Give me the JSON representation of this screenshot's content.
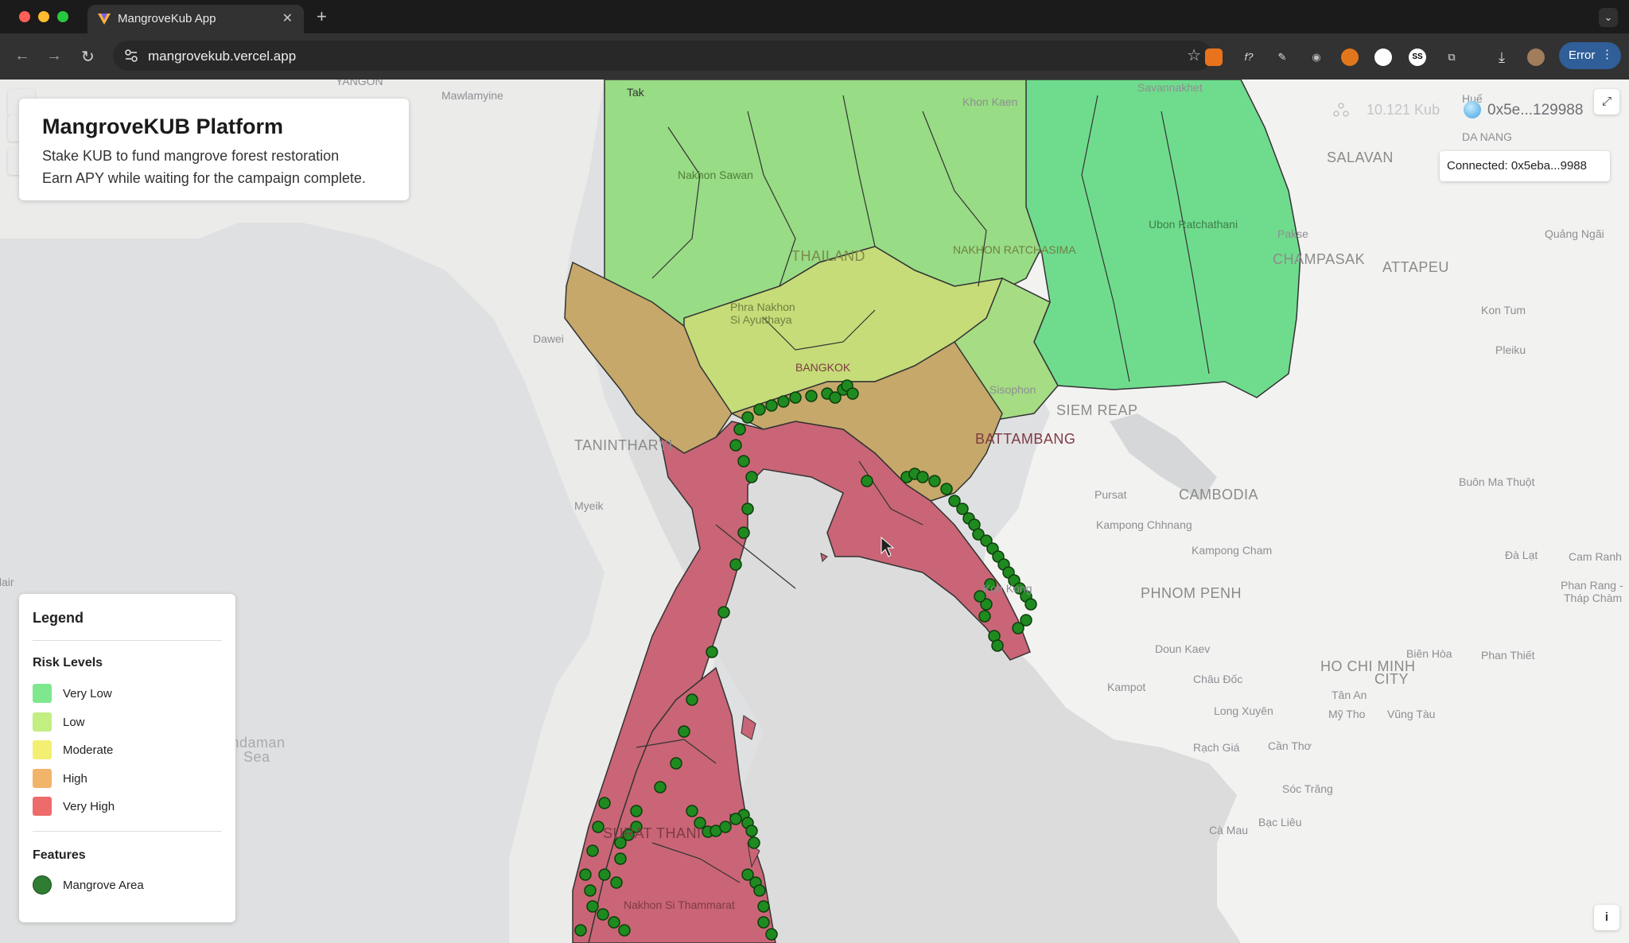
{
  "browser": {
    "tab_title": "MangroveKub App",
    "tab_close": "✕",
    "new_tab": "+",
    "tab_menu": "⌄",
    "url": "mangrovekub.vercel.app",
    "bookmark_icon": "☆",
    "error_label": "Error",
    "menu_glyph": "⋮",
    "nav": {
      "back": "←",
      "forward": "→",
      "reload": "↻"
    },
    "ext_glyphs": {
      "fx": "f?",
      "brush": "✎",
      "camera": "◉",
      "dl": "⤓",
      "puzzle": "⧉",
      "ss": "SS"
    }
  },
  "app": {
    "title": "MangroveKUB Platform",
    "line1": "Stake KUB to fund mangrove forest restoration",
    "line2": "Earn APY while waiting for the campaign complete."
  },
  "wallet": {
    "balance": "10.121 Kub",
    "address": "0x5e...129988",
    "tooltip": "Connected: 0x5eba...9988"
  },
  "controls": {
    "fullscreen": "⤢",
    "info": "i"
  },
  "legend": {
    "title": "Legend",
    "risk_heading": "Risk Levels",
    "risk_levels": [
      {
        "label": "Very Low",
        "color": "#7fe88f"
      },
      {
        "label": "Low",
        "color": "#c2ee82"
      },
      {
        "label": "Moderate",
        "color": "#f2ef72"
      },
      {
        "label": "High",
        "color": "#f2b36a"
      },
      {
        "label": "Very High",
        "color": "#ee6b6b"
      }
    ],
    "features_heading": "Features",
    "features": [
      {
        "label": "Mangrove Area",
        "color": "#2f7d32"
      }
    ]
  },
  "map_labels": {
    "yangon": "YANGON",
    "mawlamyine": "Mawlamyine",
    "tak": "Tak",
    "khon_kaen": "Khon Kaen",
    "savannakhet": "Savannakhet",
    "salavan": "SALAVAN",
    "da_nang": "DA NANG",
    "hue": "Huế",
    "pakse": "Pakse",
    "champasak": "CHAMPASAK",
    "attapeu": "ATTAPEU",
    "quang_ngai": "Quảng Ngãi",
    "kon_tum": "Kon Tum",
    "pleiku": "Pleiku",
    "thailand": "THAILAND",
    "nakhon_ratchasima": "NAKHON RATCHASIMA",
    "ubon": "Ubon Ratchathani",
    "nakhon_sawan": "Nakhon Sawan",
    "phra_nakhon": "Phra Nakhon",
    "si_ayutthaya": "Si Ayutthaya",
    "dawei": "Dawei",
    "bangkok": "BANGKOK",
    "tanintharyi": "TANINTHARYI",
    "siem_reap": "SIEM REAP",
    "battambang": "BATTAMBANG",
    "sisophon": "Sisophon",
    "pursat": "Pursat",
    "cambodia": "CAMBODIA",
    "kampong_chhnang": "Kampong Chhnang",
    "kampong_cham": "Kampong Cham",
    "buon_ma_thuot": "Buôn Ma Thuột",
    "myeik": "Myeik",
    "phnom_penh": "PHNOM PENH",
    "koh_kong": "Koh Kong",
    "da_lat": "Đà Lạt",
    "cam_ranh": "Cam Ranh",
    "phan_rang": "Phan Rang -",
    "thap_cham": "Tháp Chàm",
    "doun_kaev": "Doun Kaev",
    "chau_doc": "Châu Đốc",
    "kampot": "Kampot",
    "ho_chi_minh": "HO CHI MINH",
    "city": "CITY",
    "bien_hoa": "Biên Hòa",
    "phan_thiet": "Phan Thiết",
    "tan_an": "Tân An",
    "long_xuyen": "Long Xuyên",
    "my_tho": "Mỹ Tho",
    "vung_tau": "Vũng Tàu",
    "rach_gia": "Rạch Giá",
    "can_tho": "Cần Thơ",
    "soc_trang": "Sóc Trăng",
    "ca_mau": "Cà Mau",
    "bac_lieu": "Bạc Liêu",
    "port_blair": "Port Blair",
    "andaman": "Andaman",
    "sea": "Sea",
    "surat_thani": "SURAT THANI",
    "nakhon_si": "Nakhon Si Thammarat"
  }
}
